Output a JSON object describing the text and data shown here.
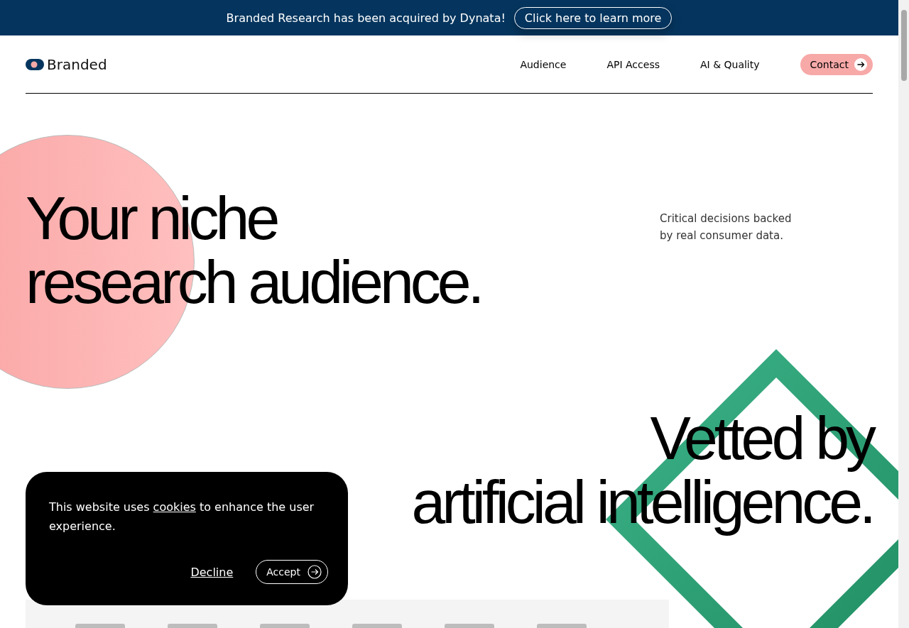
{
  "announcement": {
    "message": "Branded Research has been acquired by Dynata!",
    "link": "Click here to learn more"
  },
  "nav": {
    "brand": "Branded",
    "items": [
      "Audience",
      "API Access",
      "AI & Quality"
    ],
    "cta": "Contact"
  },
  "hero": {
    "heading_lines": [
      "Your niche",
      "research audience."
    ],
    "tagline": "Critical decisions backed by real consumer data."
  },
  "section": {
    "heading_lines": [
      "Vetted by",
      "artificial intelligence."
    ]
  },
  "cookie_banner": {
    "text_before": "This website uses",
    "link": "cookies",
    "text_after": "to enhance the user experience.",
    "decline": "Decline",
    "accept": "Accept"
  }
}
